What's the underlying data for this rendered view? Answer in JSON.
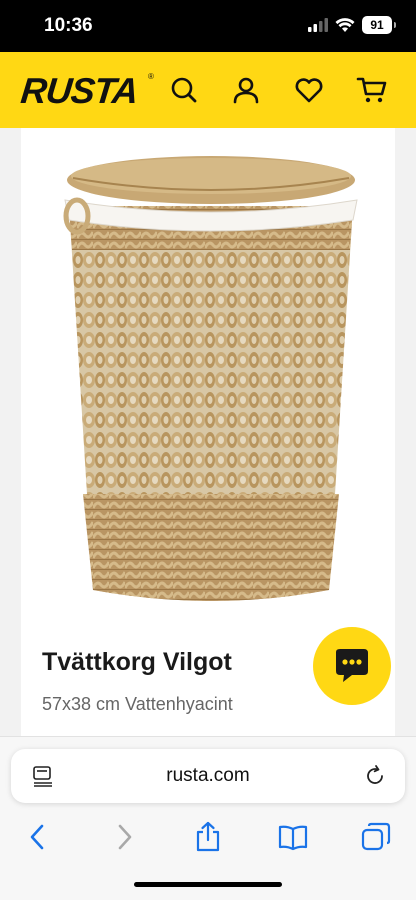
{
  "status_bar": {
    "time": "10:36",
    "battery": "91"
  },
  "header": {
    "logo": "RUSTA",
    "logo_mark": "®",
    "icons": [
      "search-icon",
      "account-icon",
      "heart-icon",
      "cart-icon"
    ],
    "accent_color": "#ffd814"
  },
  "product": {
    "title": "Tvättkorg Vilgot",
    "subtitle": "57x38 cm Vattenhyacint"
  },
  "browser": {
    "url": "rusta.com",
    "toolbar": [
      "back-icon",
      "forward-icon",
      "share-icon",
      "bookmarks-icon",
      "tabs-icon"
    ]
  }
}
